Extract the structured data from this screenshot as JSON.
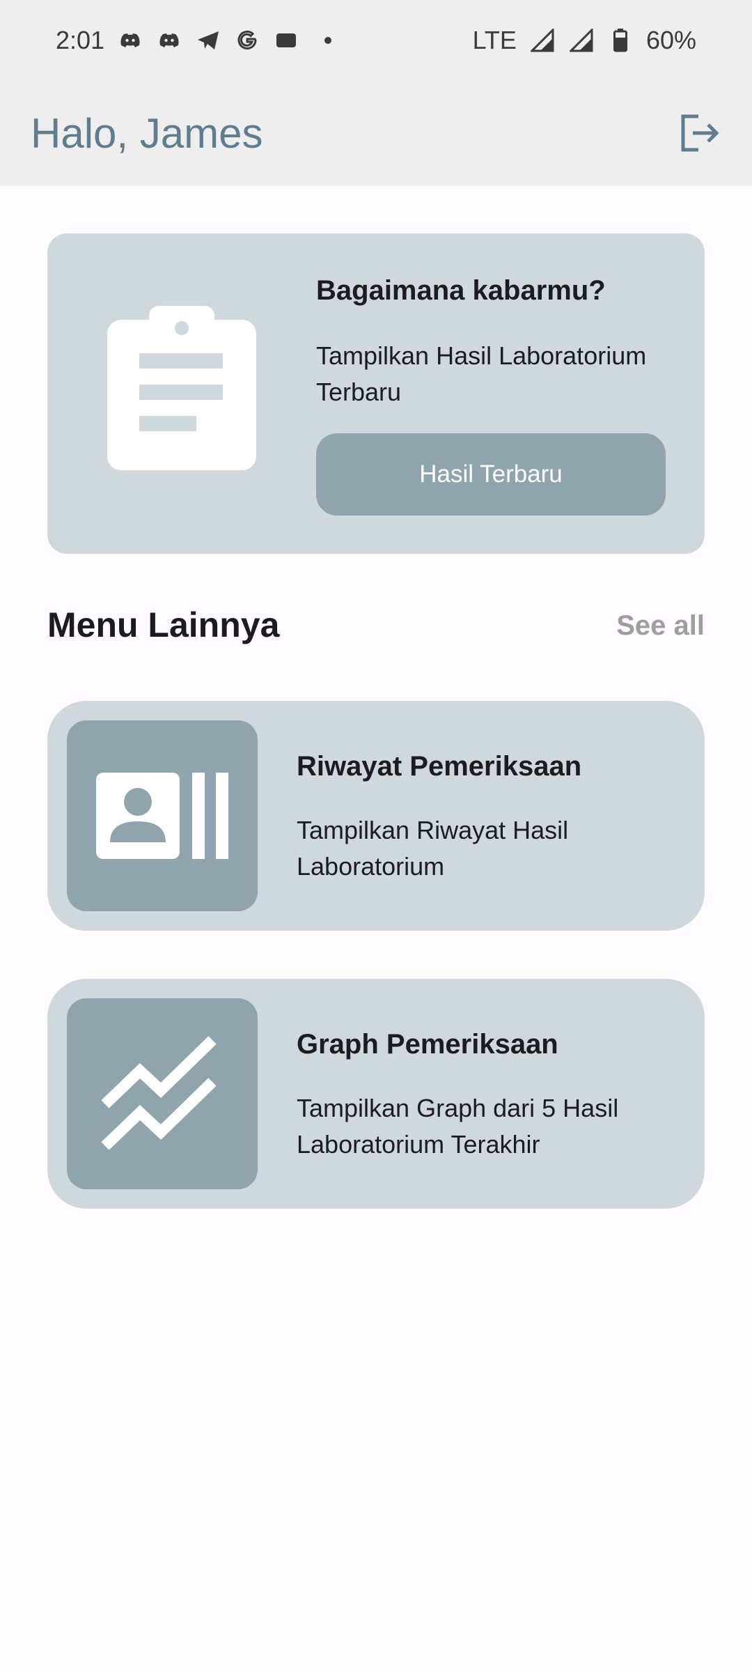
{
  "status_bar": {
    "time": "2:01",
    "network": "LTE",
    "battery": "60%",
    "icons": [
      "discord-icon",
      "discord-icon",
      "telegram-icon",
      "google-icon",
      "notification-icon",
      "signal-icon",
      "signal-icon",
      "battery-icon"
    ]
  },
  "app_bar": {
    "title": "Halo, James",
    "logout_icon": "logout-icon"
  },
  "hero": {
    "title": "Bagaimana kabarmu?",
    "subtitle": "Tampilkan Hasil Laboratorium Terbaru",
    "button_label": "Hasil Terbaru",
    "icon": "clipboard-icon"
  },
  "section": {
    "title": "Menu Lainnya",
    "see_all": "See all"
  },
  "menu": [
    {
      "title": "Riwayat Pemeriksaan",
      "subtitle": "Tampilkan Riwayat Hasil Laboratorium",
      "icon": "contact-card-icon"
    },
    {
      "title": "Graph Pemeriksaan",
      "subtitle": "Tampilkan Graph dari 5 Hasil Laboratorium Terakhir",
      "icon": "trend-chart-icon"
    }
  ],
  "colors": {
    "app_bar_bg": "#eeeeee",
    "title_color": "#5f7d8c",
    "card_bg": "#cfd8dc",
    "accent": "#90a4ae",
    "page_bg": "#fffbfe"
  }
}
